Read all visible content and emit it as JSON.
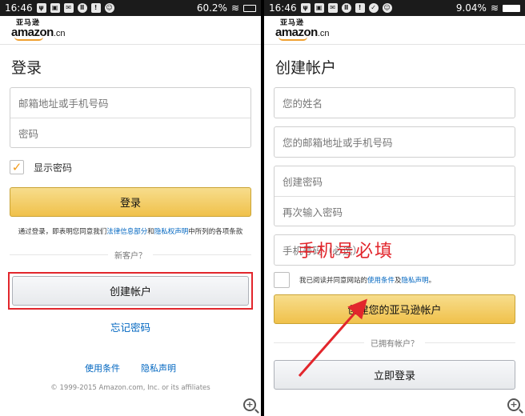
{
  "status_bar_left": {
    "time": "16:46",
    "battery": "60.2%"
  },
  "status_bar_right": {
    "time": "16:46",
    "battery": "9.04%"
  },
  "logo": {
    "cn": "亚马逊",
    "word": "amazon",
    "suffix": ".cn"
  },
  "signin": {
    "title": "登录",
    "email_placeholder": "邮箱地址或手机号码",
    "password_placeholder": "密码",
    "show_password": "显示密码",
    "signin_button": "登录",
    "terms_prefix": "通过登录，即表明您同意我们",
    "terms_link1": "法律信息部分",
    "terms_and": "和",
    "terms_link2": "隐私权声明",
    "terms_suffix": "中所列的各项条款",
    "new_customer": "新客户？",
    "create_account_button": "创建帐户",
    "forgot_password": "忘记密码",
    "footer_terms": "使用条件",
    "footer_privacy": "隐私声明",
    "copyright": "© 1999-2015 Amazon.com, Inc. or its affiliates"
  },
  "register": {
    "title": "创建帐户",
    "name_placeholder": "您的姓名",
    "email_placeholder": "您的邮箱地址或手机号码",
    "password_placeholder": "创建密码",
    "password_again_placeholder": "再次输入密码",
    "phone_placeholder": "手机号码（必选）",
    "agree_prefix": "我已阅读并同意网站的",
    "agree_link1": "使用条件",
    "agree_and": "及",
    "agree_link2": "隐私声明",
    "agree_suffix": "。",
    "create_button": "创建您的亚马逊帐户",
    "have_account": "已拥有帐户？",
    "signin_now_button": "立即登录"
  },
  "annotation": {
    "text": "手机号必填",
    "color": "#e2262c"
  },
  "colors": {
    "accent_yellow": "#f0c14b",
    "link": "#0066c0",
    "highlight_red": "#e2262c",
    "check_orange": "#f29b1a"
  }
}
